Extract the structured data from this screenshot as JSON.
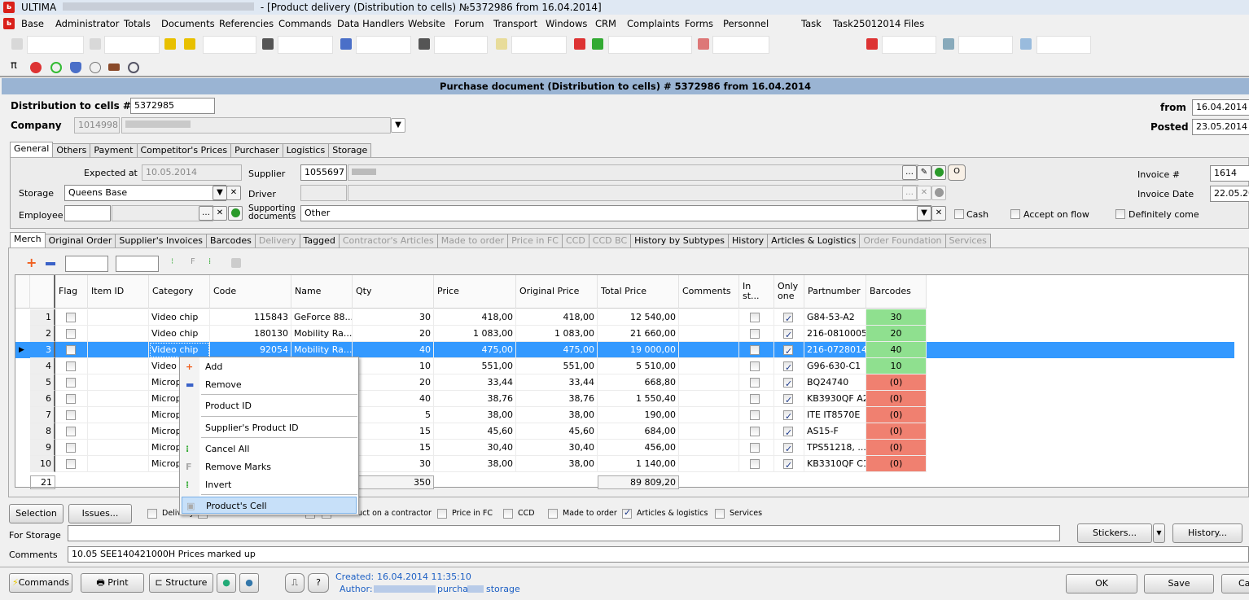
{
  "window": {
    "title_app": "ULTIMA",
    "title_doc": "- [Product delivery (Distribution to cells) №5372986 from 16.04.2014]"
  },
  "menubar": [
    "Base",
    "Administrator",
    "Totals",
    "Documents",
    "Referencies",
    "Commands",
    "Data Handlers",
    "Website",
    "Forum",
    "Transport",
    "Windows",
    "CRM",
    "Complaints",
    "Forms",
    "Personnel",
    "Task",
    "Task25012014",
    "Files"
  ],
  "doc_title": "Purchase document (Distribution to cells) # 5372986 from 16.04.2014",
  "header": {
    "dist_label": "Distribution to cells #",
    "dist_value": "5372985",
    "company_label": "Company",
    "company_id": "1014998",
    "from_label": "from",
    "from_value": "16.04.2014 1",
    "posted_label": "Posted",
    "posted_value": "23.05.2014 1"
  },
  "top_tabs": [
    "General",
    "Others",
    "Payment",
    "Competitor's Prices",
    "Purchaser",
    "Logistics",
    "Storage"
  ],
  "general": {
    "expected_label": "Expected at",
    "expected_value": "10.05.2014",
    "storage_label": "Storage",
    "storage_value": "Queens Base",
    "employee_label": "Employee",
    "supplier_label": "Supplier",
    "supplier_value": "1055697",
    "driver_label": "Driver",
    "supdocs_label": "Supporting documents",
    "supdocs_value": "Other",
    "invoice_label": "Invoice #",
    "invoice_value": "1614",
    "invdate_label": "Invoice Date",
    "invdate_value": "22.05.20",
    "cash_label": "Cash",
    "accept_label": "Accept on flow",
    "definitely_label": "Definitely come",
    "o_button": "O"
  },
  "sub_tabs": [
    {
      "label": "Merch",
      "state": "active"
    },
    {
      "label": "Original Order"
    },
    {
      "label": "Supplier's Invoices"
    },
    {
      "label": "Barcodes"
    },
    {
      "label": "Delivery",
      "state": "disabled"
    },
    {
      "label": "Tagged"
    },
    {
      "label": "Contractor's Articles",
      "state": "disabled"
    },
    {
      "label": "Made to order",
      "state": "disabled"
    },
    {
      "label": "Price in FC",
      "state": "disabled"
    },
    {
      "label": "CCD",
      "state": "disabled"
    },
    {
      "label": "CCD BC",
      "state": "disabled"
    },
    {
      "label": "History by Subtypes"
    },
    {
      "label": "History"
    },
    {
      "label": "Articles & Logistics"
    },
    {
      "label": "Order Foundation",
      "state": "disabled"
    },
    {
      "label": "Services",
      "state": "disabled"
    }
  ],
  "table": {
    "columns": [
      "Flag",
      "Item ID",
      "Category",
      "Code",
      "Name",
      "Qty",
      "Price",
      "Original Price",
      "Total Price",
      "Comments",
      "In st...",
      "Only one",
      "Partnumber",
      "Barcodes"
    ],
    "rows": [
      {
        "n": "1",
        "cat": "Video chip",
        "code": "115843",
        "name": "GeForce 88...",
        "qty": "30",
        "price": "418,00",
        "orig": "418,00",
        "total": "12 540,00",
        "inst": false,
        "only": true,
        "part": "G84-53-A2",
        "bc": "30",
        "bcstatus": "ok"
      },
      {
        "n": "2",
        "cat": "Video chip",
        "code": "180130",
        "name": "Mobility Ra...",
        "qty": "20",
        "price": "1 083,00",
        "orig": "1 083,00",
        "total": "21 660,00",
        "inst": false,
        "only": true,
        "part": "216-0810005",
        "bc": "20",
        "bcstatus": "ok"
      },
      {
        "n": "3",
        "cat": "Video chip",
        "code": "92054",
        "name": "Mobility Ra...",
        "qty": "40",
        "price": "475,00",
        "orig": "475,00",
        "total": "19 000,00",
        "inst": false,
        "only": true,
        "part": "216-0728014",
        "bc": "40",
        "bcstatus": "ok",
        "selected": true
      },
      {
        "n": "4",
        "cat": "Video c",
        "code": "",
        "name": "",
        "qty": "10",
        "price": "551,00",
        "orig": "551,00",
        "total": "5 510,00",
        "inst": false,
        "only": true,
        "part": "G96-630-C1",
        "bc": "10",
        "bcstatus": "ok"
      },
      {
        "n": "5",
        "cat": "Microp",
        "code": "",
        "name": "",
        "qty": "20",
        "price": "33,44",
        "orig": "33,44",
        "total": "668,80",
        "inst": false,
        "only": true,
        "part": "BQ24740",
        "bc": "(0)",
        "bcstatus": "missing"
      },
      {
        "n": "6",
        "cat": "Microp",
        "code": "",
        "name": "",
        "qty": "40",
        "price": "38,76",
        "orig": "38,76",
        "total": "1 550,40",
        "inst": false,
        "only": true,
        "part": "KB3930QF A2",
        "bc": "(0)",
        "bcstatus": "missing"
      },
      {
        "n": "7",
        "cat": "Microp",
        "code": "",
        "name": "",
        "qty": "5",
        "price": "38,00",
        "orig": "38,00",
        "total": "190,00",
        "inst": false,
        "only": true,
        "part": "ITE IT8570E",
        "bc": "(0)",
        "bcstatus": "missing"
      },
      {
        "n": "8",
        "cat": "Microp",
        "code": "",
        "name": "",
        "qty": "15",
        "price": "45,60",
        "orig": "45,60",
        "total": "684,00",
        "inst": false,
        "only": true,
        "part": " AS15-F",
        "bc": "(0)",
        "bcstatus": "missing"
      },
      {
        "n": "9",
        "cat": "Microp",
        "code": "",
        "name": "",
        "qty": "15",
        "price": "30,40",
        "orig": "30,40",
        "total": "456,00",
        "inst": false,
        "only": true,
        "part": "TPS51218, ...",
        "bc": "(0)",
        "bcstatus": "missing"
      },
      {
        "n": "10",
        "cat": "Microp",
        "code": "",
        "name": "",
        "qty": "30",
        "price": "38,00",
        "orig": "38,00",
        "total": "1 140,00",
        "inst": false,
        "only": true,
        "part": "KB3310QF C1",
        "bc": "(0)",
        "bcstatus": "missing"
      }
    ],
    "totals": {
      "count": "21",
      "qty": "350",
      "total": "89 809,20"
    }
  },
  "context_menu": [
    "Add",
    "Remove",
    "Product ID",
    "Supplier's Product ID",
    "Cancel All",
    "Remove Marks",
    "Invert",
    "Product's Cell"
  ],
  "bottom": {
    "selection": "Selection",
    "issues": "Issues...",
    "filters": [
      {
        "label": "Delivery",
        "checked": false
      },
      {
        "label": "Product on a contractor",
        "checked": false
      },
      {
        "label": "Price in FC",
        "checked": false
      },
      {
        "label": "CCD",
        "checked": false
      },
      {
        "label": "Made to order",
        "checked": false
      },
      {
        "label": "Articles & logistics",
        "checked": true
      },
      {
        "label": "Services",
        "checked": false
      }
    ],
    "for_storage_label": "For Storage",
    "comments_label": "Comments",
    "comments_value": "10.05  SEE140421000H Prices marked up",
    "stickers": "Stickers...",
    "history": "History...",
    "commands": "Commands",
    "print": "Print",
    "structure": "Structure",
    "help": "?",
    "created_label": "Created:",
    "created_value": "16.04.2014 11:35:10",
    "author_label": "Author:",
    "author_value": "purchase",
    "author_value2": "storage",
    "ok": "OK",
    "save": "Save",
    "cancel": "Ca"
  },
  "colors": {
    "selected_row": "#3399ff",
    "barcode_ok": "#8fe08f",
    "barcode_missing": "#f08070",
    "doc_title_bg": "#9ab4d3",
    "link_blue": "#1c5fc4"
  }
}
